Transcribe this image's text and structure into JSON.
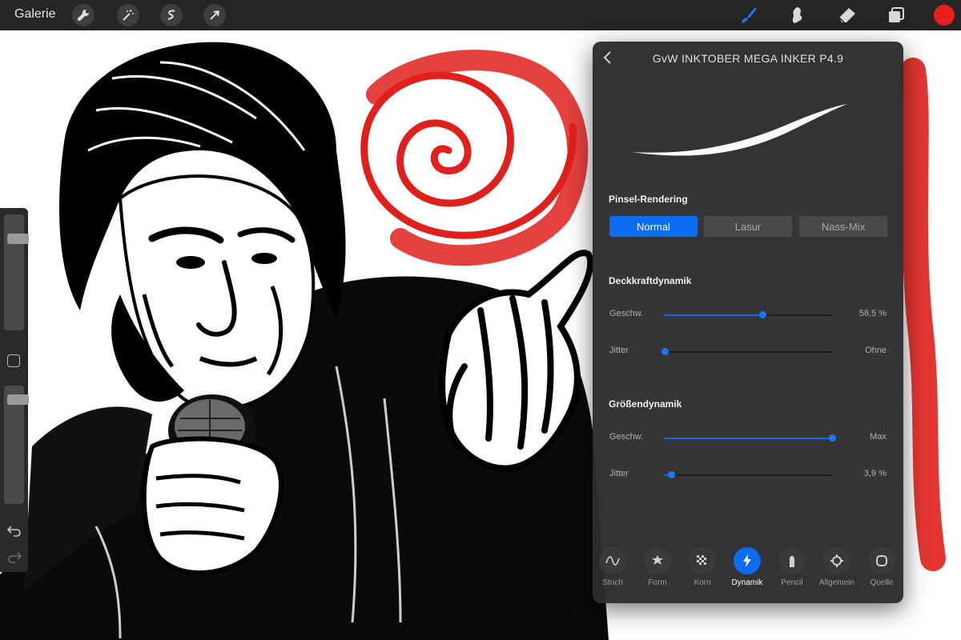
{
  "topbar": {
    "gallery_label": "Galerie",
    "left_tools": [
      {
        "name": "wrench-icon"
      },
      {
        "name": "magic-wand-icon"
      },
      {
        "name": "selection-s-icon"
      },
      {
        "name": "arrow-cursor-icon"
      }
    ],
    "right_tools": [
      {
        "name": "brush-icon",
        "active": true
      },
      {
        "name": "smudge-icon"
      },
      {
        "name": "eraser-icon"
      },
      {
        "name": "layers-icon"
      }
    ],
    "current_color": "#e8201c"
  },
  "sidebar": {
    "brush_size_level": 0.18,
    "opacity_level": 0.08
  },
  "panel": {
    "title": "GvW INKTOBER MEGA INKER P4.9",
    "rendering": {
      "title": "Pinsel-Rendering",
      "options": [
        "Normal",
        "Lasur",
        "Nass-Mix"
      ],
      "selected": "Normal"
    },
    "opacity_dynamics": {
      "title": "Deckkraftdynamik",
      "rows": [
        {
          "label": "Geschw.",
          "value": "58,5 %",
          "level": 0.585
        },
        {
          "label": "Jitter",
          "value": "Ohne",
          "level": 0.0
        }
      ]
    },
    "size_dynamics": {
      "title": "Größendynamik",
      "rows": [
        {
          "label": "Geschw.",
          "value": "Max",
          "level": 1.0
        },
        {
          "label": "Jitter",
          "value": "3,9 %",
          "level": 0.039
        }
      ]
    },
    "tabs": [
      {
        "label": "Strich",
        "icon": "stroke-path-icon"
      },
      {
        "label": "Form",
        "icon": "shape-icon"
      },
      {
        "label": "Korn",
        "icon": "grain-icon"
      },
      {
        "label": "Dynamik",
        "icon": "lightning-icon",
        "active": true
      },
      {
        "label": "Pencil",
        "icon": "pencil-icon"
      },
      {
        "label": "Allgemein",
        "icon": "settings-icon"
      },
      {
        "label": "Quelle",
        "icon": "source-icon"
      }
    ]
  },
  "colors": {
    "accent": "#0a6cf0",
    "ink": "#000000",
    "paint_red": "#e0201c"
  }
}
